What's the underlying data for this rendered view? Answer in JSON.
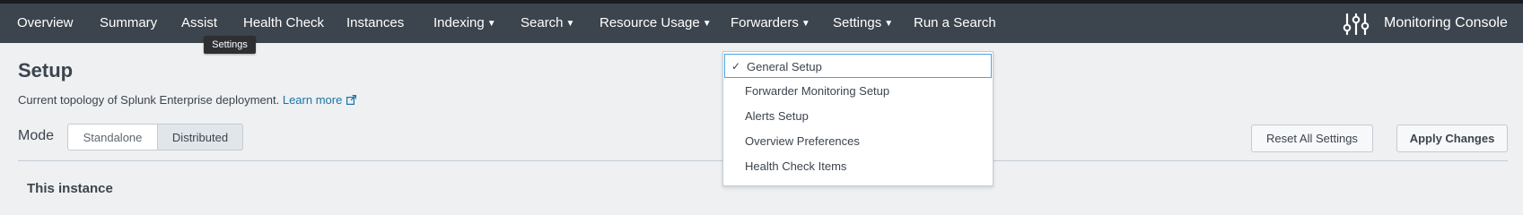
{
  "nav": {
    "items": [
      {
        "label": "Overview"
      },
      {
        "label": "Summary"
      },
      {
        "label": "Assist"
      },
      {
        "label": "Health Check"
      },
      {
        "label": "Instances"
      },
      {
        "label": "Indexing"
      },
      {
        "label": "Search"
      },
      {
        "label": "Resource Usage"
      },
      {
        "label": "Forwarders"
      },
      {
        "label": "Settings"
      },
      {
        "label": "Run a Search"
      }
    ],
    "app_title": "Monitoring Console",
    "app_icon": "sliders-icon"
  },
  "tooltip": {
    "text": "Settings"
  },
  "settings_menu": {
    "items": [
      {
        "label": "General Setup",
        "selected": true
      },
      {
        "label": "Forwarder Monitoring Setup"
      },
      {
        "label": "Alerts Setup"
      },
      {
        "label": "Overview Preferences"
      },
      {
        "label": "Health Check Items"
      }
    ],
    "check_icon": "checkmark-icon"
  },
  "page": {
    "title": "Setup",
    "subtitle": "Current topology of Splunk Enterprise deployment.",
    "learn_more": "Learn more",
    "mode_label": "Mode",
    "mode_options": [
      "Standalone",
      "Distributed"
    ],
    "mode_selected": "Distributed",
    "reset_label": "Reset All Settings",
    "apply_label": "Apply Changes",
    "section_heading": "This instance"
  },
  "colors": {
    "navbar": "#3c444d",
    "page_bg": "#eef0f2",
    "link": "#1a73a8",
    "focus": "#4aa3df"
  }
}
